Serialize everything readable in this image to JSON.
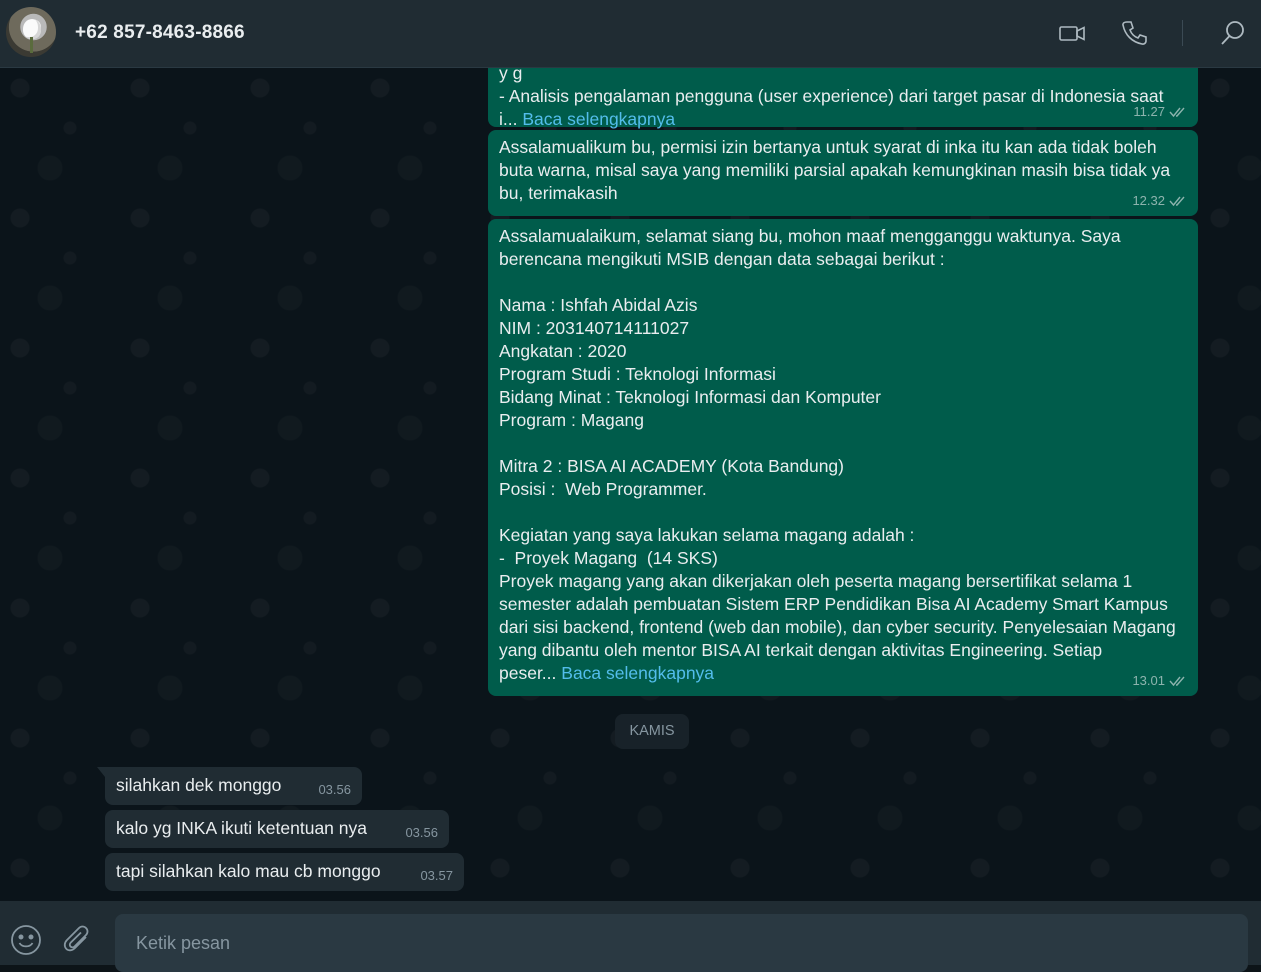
{
  "header": {
    "contact_name": "+62 857-8463-8866",
    "icons": [
      "avatar",
      "video-call-icon",
      "voice-call-icon",
      "search-icon"
    ]
  },
  "messages": {
    "m1": {
      "lines": [
        "- Analisis pengalaman pengguna (user experience) dari target pasar di Indonesia saat"
      ],
      "last_prefix": "i...",
      "read_more": "Baca selengkapnya",
      "time": "11.27"
    },
    "m2": {
      "lines": [
        "Assalamualikum bu, permisi izin bertanya untuk syarat di inka itu kan ada tidak boleh",
        "buta warna, misal saya yang memiliki parsial apakah kemungkinan masih bisa tidak ya",
        "bu, terimakasih"
      ],
      "time": "12.32"
    },
    "m3": {
      "lines": [
        "Assalamualaikum, selamat siang bu, mohon maaf mengganggu waktunya. Saya",
        "berencana mengikuti MSIB dengan data sebagai berikut :",
        "",
        "Nama : Ishfah Abidal Azis",
        "NIM : 203140714111027",
        "Angkatan : 2020",
        "Program Studi : Teknologi Informasi",
        "Bidang Minat : Teknologi Informasi dan Komputer",
        "Program : Magang",
        "",
        "Mitra 2 : BISA AI ACADEMY (Kota Bandung)",
        "Posisi :  Web Programmer.",
        "",
        "Kegiatan yang saya lakukan selama magang adalah :",
        "-  Proyek Magang  (14 SKS)",
        "Proyek magang yang akan dikerjakan oleh peserta magang bersertifikat selama 1",
        "semester adalah pembuatan Sistem ERP Pendidikan Bisa AI Academy Smart Kampus",
        "dari sisi backend, frontend (web dan mobile), dan cyber security. Penyelesaian Magang",
        "yang dibantu oleh mentor BISA AI terkait dengan aktivitas Engineering. Setiap"
      ],
      "last_prefix": "peser...",
      "read_more": "Baca selengkapnya",
      "time": "13.01"
    },
    "day_badge": "KAMIS",
    "in1": {
      "text": "silahkan dek monggo",
      "time": "03.56"
    },
    "in2": {
      "text": "kalo yg INKA ikuti ketentuan nya",
      "time": "03.56"
    },
    "in3": {
      "text": "tapi silahkan kalo mau cb monggo",
      "time": "03.57"
    }
  },
  "composer": {
    "placeholder": "Ketik pesan",
    "icons": [
      "emoji-icon",
      "attach-icon"
    ]
  },
  "colors": {
    "outgoing_bubble": "#005c4b",
    "incoming_bubble": "#202c33",
    "link": "#53bdeb",
    "header_bg": "#202c33"
  }
}
